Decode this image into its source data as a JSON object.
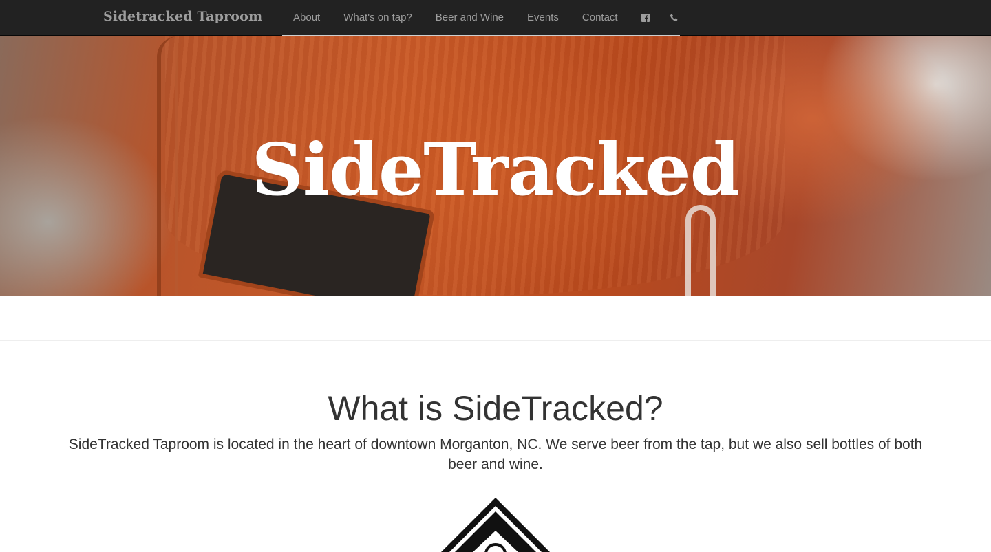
{
  "navbar": {
    "brand": "Sidetracked Taproom",
    "items": [
      {
        "label": "About"
      },
      {
        "label": "What's on tap?"
      },
      {
        "label": "Beer and Wine"
      },
      {
        "label": "Events"
      },
      {
        "label": "Contact"
      }
    ],
    "icons": [
      "facebook-icon",
      "phone-icon"
    ]
  },
  "hero": {
    "title": "SideTracked"
  },
  "about": {
    "heading": "What is SideTracked?",
    "text": "SideTracked Taproom is located in the heart of downtown Morganton, NC. We serve beer from the tap, but we also sell bottles of both beer and wine."
  },
  "colors": {
    "navbar_bg": "#222222",
    "nav_text": "#9d9d9d",
    "hero_accent": "#c85a28",
    "body_text": "#333333"
  }
}
